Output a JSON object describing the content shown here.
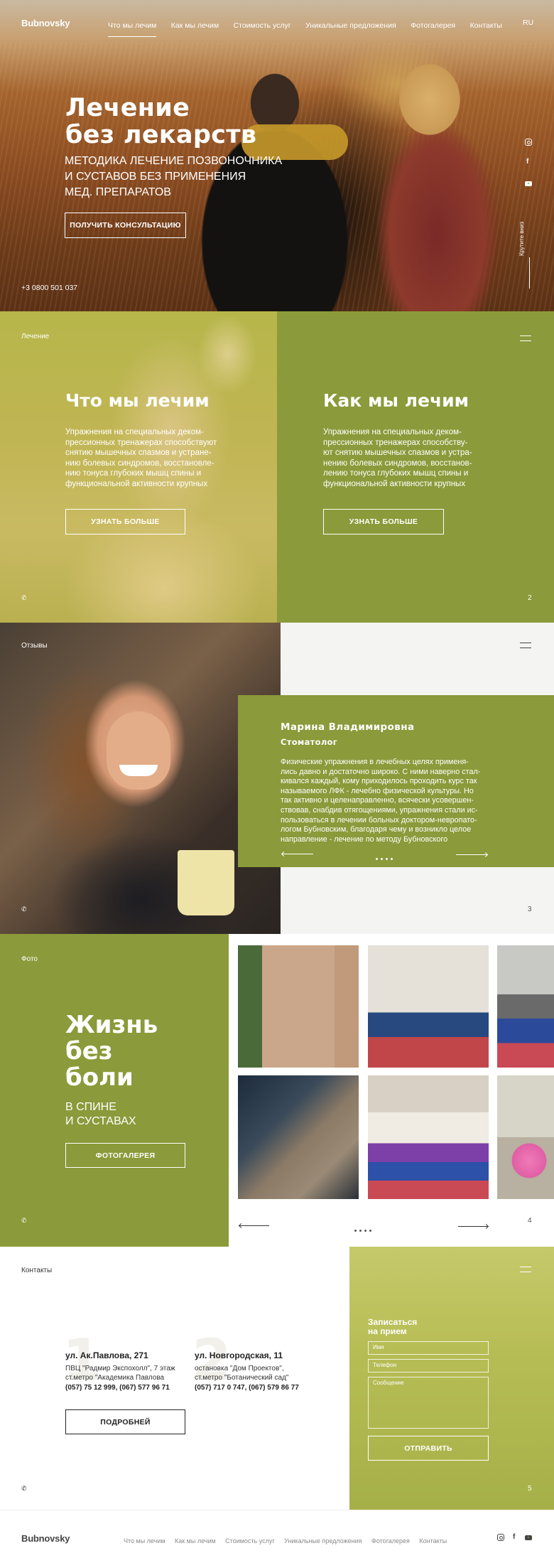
{
  "brand": {
    "logo": "Bubnovsky",
    "accent": "#8b9a3a"
  },
  "nav": {
    "items": [
      "Что мы лечим",
      "Как мы лечим",
      "Стоимость услуг",
      "Уникальные предложения",
      "Фотогалерея",
      "Контакты"
    ],
    "lang": "RU"
  },
  "hero": {
    "title_line1": "Лечение",
    "title_line2": "без лекарств",
    "sub_line1": "МЕТОДИКА ЛЕЧЕНИЕ ПОЗВОНОЧНИКА",
    "sub_line2": "И СУСТАВОВ БЕЗ ПРИМЕНЕНИЯ",
    "sub_line3": "МЕД. ПРЕПАРАТОВ",
    "cta": "ПОЛУЧИТЬ КОНСУЛЬТАЦИЮ",
    "phone": "+3 0800 501 037",
    "scroll": "Крутите вниз",
    "social": [
      "instagram-icon",
      "facebook-icon",
      "youtube-icon"
    ]
  },
  "treatment": {
    "label": "Лечение",
    "left": {
      "title": "Что мы лечим",
      "text": [
        "Упражнения на специальных деком-",
        "прессионных тренажерах способствуют",
        "снятию мышечных спазмов и устране-",
        "нию болевых синдромов, восстановле-",
        "нию тонуса глубоких мышц спины и",
        "функциональной активности крупных"
      ],
      "button": "УЗНАТЬ БОЛЬШЕ"
    },
    "right": {
      "title": "Как мы лечим",
      "text": [
        "Упражнения на специальных деком-",
        "прессионных тренажерах способству-",
        "ют снятию мышечных спазмов и устра-",
        "нению болевых синдромов, восстанов-",
        "лению тонуса глубоких мышц спины и",
        "функциональной активности крупных"
      ],
      "button": "УЗНАТЬ БОЛЬШЕ"
    },
    "page": "2"
  },
  "review": {
    "label": "Отзывы",
    "name": "Марина Владимировна",
    "role": "Стоматолог",
    "text": [
      "Физические упражнения в лечебных целях применя-",
      "лись давно и достаточно широко. С ними наверно стал-",
      "кивался каждый, кому приходилось проходить курс так",
      "называемого ЛФК - лечебно физической культуры. Но",
      "так активно и целенаправленно, всячески усовершен-",
      "ствовав, снабдив отягощениями, упражнения стали ис-",
      "пользоваться в лечении больных доктором-невропато-",
      "логом Бубновским, благодаря чему и возникло целое",
      "направление - лечение по методу Бубновского"
    ],
    "page": "3"
  },
  "gallery": {
    "label": "Фото",
    "title_line1": "Жизнь",
    "title_line2": "без",
    "title_line3": "боли",
    "sub_line1": "В СПИНЕ",
    "sub_line2": "И СУСТАВАХ",
    "button": "ФОТОГАЛЕРЕЯ",
    "page": "4"
  },
  "contacts": {
    "label": "Контакты",
    "addresses": [
      {
        "num": "1",
        "title": "ул. Ак.Павлова, 271",
        "line1": "ПВЦ \"Радмир Экспохолл\", 7 этаж",
        "line2": "ст.метро \"Академика Павлова",
        "phones": "(057) 75 12 999, (067) 577 96 71"
      },
      {
        "num": "2",
        "title": "ул. Новгородская, 11",
        "line1": "остановка \"Дом Проектов\",",
        "line2": "ст.метро \"Ботанический сад\"",
        "phones": "(057) 717 0 747, (067) 579 86 77"
      }
    ],
    "more": "ПОДРОБНЕЙ",
    "form": {
      "title_line1": "Записаться",
      "title_line2": "на прием",
      "name_placeholder": "Имя",
      "phone_placeholder": "Телефон",
      "message_placeholder": "Сообщение",
      "submit": "ОТПРАВИТЬ"
    },
    "page": "5"
  },
  "footer": {
    "logo": "Bubnovsky",
    "items": [
      "Что мы лечим",
      "Как мы лечим",
      "Стоимость услуг",
      "Уникальные предложения",
      "Фотогалерея",
      "Контакты"
    ]
  }
}
